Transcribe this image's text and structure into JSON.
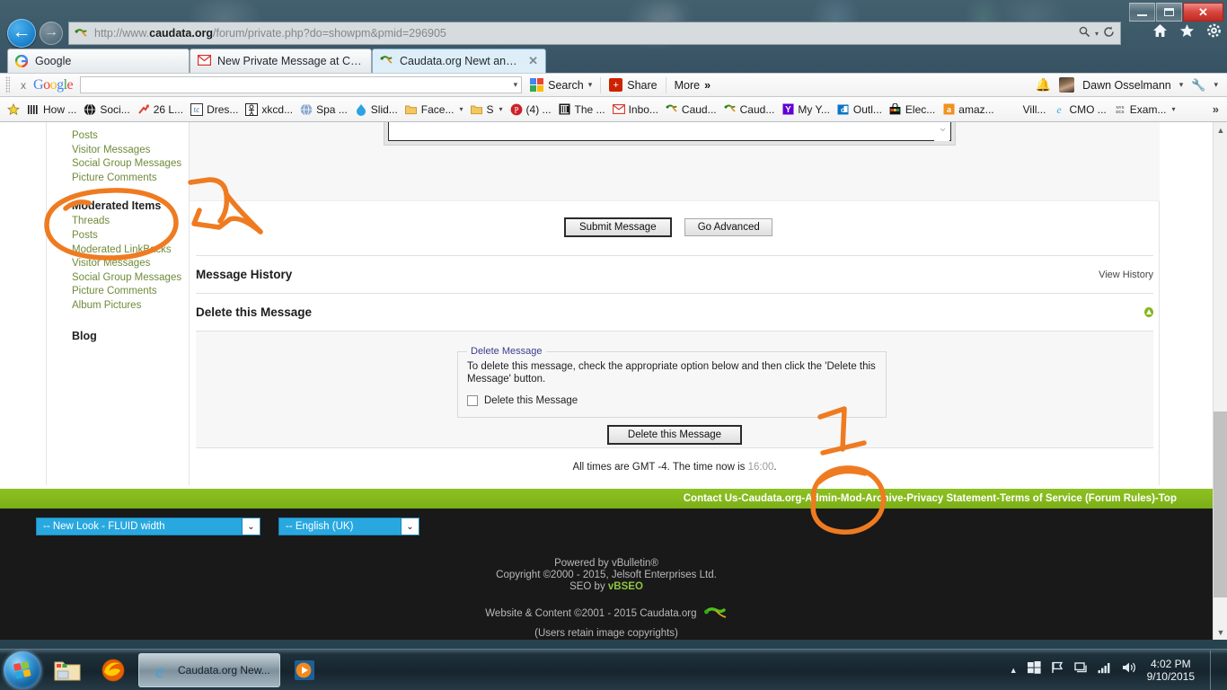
{
  "window": {
    "minimize": "–",
    "maximize": "□",
    "close": "✕"
  },
  "browser": {
    "url_scheme": "http://www.",
    "url_domain": "caudata.org",
    "url_path": "/forum/private.php?do=showpm&pmid=296905",
    "favicon_name": "salamander-favicon",
    "toolbar_icons": [
      "home-icon",
      "favorites-star-icon",
      "settings-gear-icon"
    ],
    "search_icon": "search-magnifier-icon",
    "refresh_icon": "refresh-icon",
    "tabs": [
      {
        "label": "Google",
        "icon": "google-g-icon",
        "active": false
      },
      {
        "label": "New Private Message at Cauda...",
        "icon": "gmail-envelope-icon",
        "active": false
      },
      {
        "label": "Caudata.org Newt and Sala...",
        "icon": "salamander-favicon",
        "active": true,
        "close": "✕"
      }
    ]
  },
  "google_toolbar": {
    "close_label": "x",
    "logo": "Google",
    "search_value": "",
    "dropdown_caret": "▾",
    "search_label": "Search",
    "share_label": "Share",
    "more_label": "More",
    "more_chevron": "»",
    "bell_icon": "notifications-bell-icon",
    "user_name": "Dawn Osselmann",
    "wrench_icon": "wrench-settings-icon"
  },
  "bookmarks": {
    "star_icon": "favorites-star-icon",
    "overflow": "»",
    "items": [
      {
        "label": "How ...",
        "icon": "bars-icon",
        "caret": ""
      },
      {
        "label": "Soci...",
        "icon": "globe-dark-icon",
        "caret": ""
      },
      {
        "label": "26 L...",
        "icon": "red-arrow-icon",
        "caret": ""
      },
      {
        "label": "Dres...",
        "icon": "tc-icon",
        "caret": ""
      },
      {
        "label": "xkcd...",
        "icon": "xkcd-icon",
        "caret": ""
      },
      {
        "label": "Spa ...",
        "icon": "blue-globe-icon",
        "caret": ""
      },
      {
        "label": "Slid...",
        "icon": "drupal-drop-icon",
        "caret": ""
      },
      {
        "label": "Face...",
        "icon": "folder-icon",
        "caret": "▾"
      },
      {
        "label": "S",
        "icon": "folder-icon",
        "caret": "▾"
      },
      {
        "label": "(4) ...",
        "icon": "pinterest-icon",
        "caret": ""
      },
      {
        "label": "The ...",
        "icon": "building-icon",
        "caret": ""
      },
      {
        "label": "Inbo...",
        "icon": "gmail-envelope-icon",
        "caret": ""
      },
      {
        "label": "Caud...",
        "icon": "salamander-favicon",
        "caret": ""
      },
      {
        "label": "Caud...",
        "icon": "salamander-favicon",
        "caret": ""
      },
      {
        "label": "My Y...",
        "icon": "yahoo-icon",
        "caret": ""
      },
      {
        "label": "Outl...",
        "icon": "outlook-icon",
        "caret": ""
      },
      {
        "label": "Elec...",
        "icon": "shopping-bag-icon",
        "caret": ""
      },
      {
        "label": "amaz...",
        "icon": "amazon-icon",
        "caret": ""
      },
      {
        "label": "Vill...",
        "icon": "",
        "caret": ""
      },
      {
        "label": "CMO ...",
        "icon": "ie-icon",
        "caret": ""
      },
      {
        "label": "Exam...",
        "icon": "nysdcs-icon",
        "caret": "▾"
      }
    ]
  },
  "sidebar": {
    "top_links": [
      "Posts",
      "Visitor Messages",
      "Social Group Messages",
      "Picture Comments"
    ],
    "moderated_heading": "Moderated Items",
    "moderated_links": [
      "Threads",
      "Posts",
      "Moderated LinkBacks",
      "Visitor Messages",
      "Social Group Messages",
      "Picture Comments",
      "Album Pictures"
    ],
    "blog_heading": "Blog"
  },
  "compose": {
    "textarea_value": "",
    "scroll_chevron": "⌄",
    "submit_label": "Submit Message",
    "advanced_label": "Go Advanced"
  },
  "sections": {
    "message_history_title": "Message History",
    "view_history_label": "View History",
    "delete_section_title": "Delete this Message",
    "collapse_icon": "collapse-up-arrow-icon"
  },
  "delete_panel": {
    "legend": "Delete Message",
    "instructions": "To delete this message, check the appropriate option below and then click the 'Delete this Message' button.",
    "checkbox_label": "Delete this Message",
    "checkbox_checked": false,
    "button_label": "Delete this Message"
  },
  "footer": {
    "times_prefix": "All times are GMT -4. The time now is",
    "time_now": "16:00",
    "times_suffix": ".",
    "links": [
      "Contact Us",
      "Caudata.org",
      "Admin",
      "Mod",
      "Archive",
      "Privacy Statement",
      "Terms of Service (Forum Rules)",
      "Top"
    ],
    "link_separator": " - ",
    "style_select": "-- New Look - FLUID width",
    "language_select": "-- English (UK)",
    "select_caret": "⌄",
    "copyright_lines": [
      "Powered by vBulletin®",
      "Copyright ©2000 - 2015, Jelsoft Enterprises Ltd."
    ],
    "seo_prefix": "SEO by ",
    "seo_link": "vBSEO",
    "website_copyright": "Website & Content ©2001 - 2015 Caudata.org",
    "gecko_icon": "green-gecko-icon",
    "users_retain": "(Users retain image copyrights)"
  },
  "annotations": {
    "circle_moderated_items": "orange-ellipse-around-moderated-items",
    "arrow_to_moderated": "orange-arrow-pointing-left",
    "numeral_one": "orange-handwritten-1",
    "circle_mod_link": "orange-circle-around-mod-link",
    "ink_color": "#ef7b21"
  },
  "taskbar": {
    "start_label": "start-orb",
    "items": [
      {
        "label": "",
        "icon": "explorer-folder-icon",
        "active": false
      },
      {
        "label": "",
        "icon": "firefox-icon",
        "active": false
      },
      {
        "label": "Caudata.org New...",
        "icon": "ie-icon",
        "active": true
      },
      {
        "label": "",
        "icon": "media-player-icon",
        "active": false
      }
    ],
    "tray_icons": [
      "show-hidden-icons-arrow",
      "windows-flag-icon",
      "action-center-flag-icon",
      "network-icon",
      "signal-bars-icon",
      "volume-icon"
    ],
    "time": "4:02 PM",
    "date": "9/10/2015"
  },
  "colors": {
    "accent_green": "#84b81c",
    "link_green": "#6f8b3a",
    "select_blue": "#29a8e0",
    "annotation_orange": "#ef7b21"
  }
}
